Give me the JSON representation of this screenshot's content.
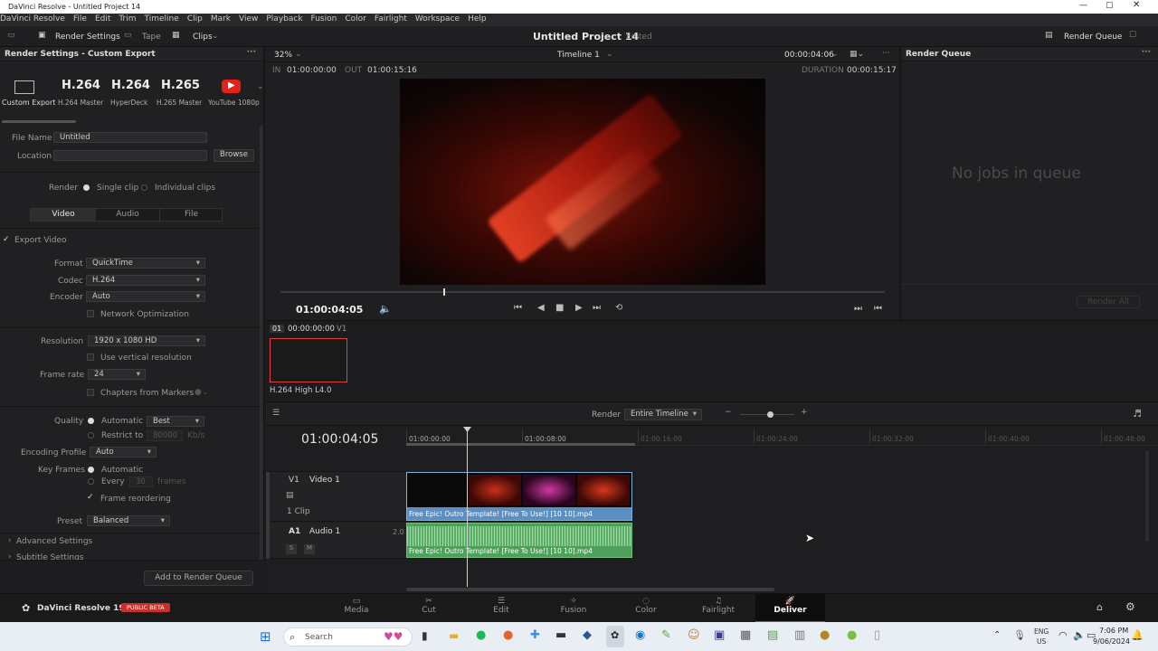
{
  "window": {
    "title": "DaVinci Resolve - Untitled Project 14"
  },
  "menu": [
    "DaVinci Resolve",
    "File",
    "Edit",
    "Trim",
    "Timeline",
    "Clip",
    "Mark",
    "View",
    "Playback",
    "Fusion",
    "Color",
    "Fairlight",
    "Workspace",
    "Help"
  ],
  "toolbar": {
    "render_settings": "Render Settings",
    "tape": "Tape",
    "clips": "Clips",
    "project": "Untitled Project 14",
    "edited": "Edited",
    "render_queue": "Render Queue"
  },
  "render_settings": {
    "header": "Render Settings - Custom Export",
    "presets": [
      {
        "title": "",
        "label": "Custom Export"
      },
      {
        "title": "H.264",
        "label": "H.264 Master"
      },
      {
        "title": "H.264",
        "label": "HyperDeck"
      },
      {
        "title": "H.265",
        "label": "H.265 Master"
      },
      {
        "title": "",
        "label": "YouTube 1080p"
      }
    ],
    "file_name_label": "File Name",
    "file_name": "Untitled",
    "location_label": "Location",
    "browse": "Browse",
    "render_label": "Render",
    "single_clip": "Single clip",
    "individual_clips": "Individual clips",
    "tabs": [
      "Video",
      "Audio",
      "File"
    ],
    "export_video": "Export Video",
    "format_label": "Format",
    "format": "QuickTime",
    "codec_label": "Codec",
    "codec": "H.264",
    "encoder_label": "Encoder",
    "encoder": "Auto",
    "network_opt": "Network Optimization",
    "resolution_label": "Resolution",
    "resolution": "1920 x 1080 HD",
    "vertical_res": "Use vertical resolution",
    "frame_rate_label": "Frame rate",
    "frame_rate": "24",
    "chapters": "Chapters from Markers",
    "quality_label": "Quality",
    "automatic": "Automatic",
    "best": "Best",
    "restrict": "Restrict to",
    "restrict_val": "80000",
    "kbs": "Kb/s",
    "encoding_profile_label": "Encoding Profile",
    "encoding_profile": "Auto",
    "key_frames_label": "Key Frames",
    "kf_auto": "Automatic",
    "every": "Every",
    "every_val": "30",
    "frames": "frames",
    "frame_reordering": "Frame reordering",
    "preset_label": "Preset",
    "preset": "Balanced",
    "advanced": "Advanced Settings",
    "subtitle": "Subtitle Settings",
    "add_queue": "Add to Render Queue"
  },
  "viewer": {
    "zoom": "32%",
    "timeline_name": "Timeline 1",
    "tc_top": "00:00:04:06",
    "in_label": "IN",
    "in_tc": "01:00:00:00",
    "out_label": "OUT",
    "out_tc": "01:00:15:16",
    "duration_label": "DURATION",
    "duration": "00:00:15:17",
    "timecode": "01:00:04:05",
    "playhead_fraction": 0.27
  },
  "clip_strip": {
    "index": "01",
    "tc": "00:00:00:00",
    "track": "V1",
    "codec": "H.264 High L4.0"
  },
  "render_queue": {
    "title": "Render Queue",
    "empty": "No jobs in queue",
    "render_all": "Render All"
  },
  "timeline": {
    "render_label": "Render",
    "render_mode": "Entire Timeline",
    "timecode": "01:00:04:05",
    "ruler": [
      "01:00:00:00",
      "01:00:08:00",
      "01:00:16:00",
      "01:00:24:00",
      "01:00:32:00",
      "01:00:40:00",
      "01:00:48:00"
    ],
    "v1": "V1",
    "v1_name": "Video 1",
    "clip_count": "1 Clip",
    "a1": "A1",
    "a1_name": "Audio 1",
    "a1_ch": "2.0",
    "s": "S",
    "m": "M",
    "video_clip": "Free Epic! Outro Template! [Free To Use!] [10 10].mp4",
    "audio_clip": "Free Epic! Outro Template! [Free To Use!] [10 10].mp4"
  },
  "bottom": {
    "app": "DaVinci Resolve 19",
    "beta": "PUBLIC BETA",
    "pages": [
      "Media",
      "Cut",
      "Edit",
      "Fusion",
      "Color",
      "Fairlight",
      "Deliver"
    ]
  },
  "taskbar": {
    "search": "Search",
    "lang": "ENG",
    "region": "US",
    "time": "7:06 PM",
    "date": "9/06/2024"
  },
  "colors": {
    "accent": "#e8324a",
    "video_clip": "#5b8fc4",
    "audio_clip": "#4ea05a"
  }
}
